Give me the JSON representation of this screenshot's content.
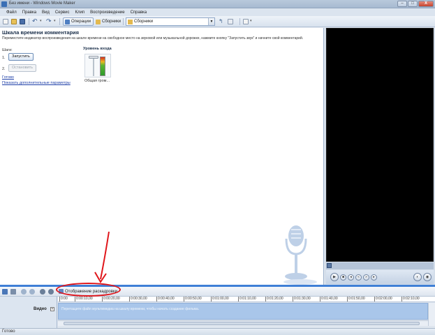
{
  "window": {
    "title": "Без имени - Windows Movie Maker",
    "minimize": "–",
    "maximize": "□",
    "close": "X"
  },
  "menu": [
    "Файл",
    "Правка",
    "Вид",
    "Сервис",
    "Клип",
    "Воспроизведение",
    "Справка"
  ],
  "toolbar": {
    "operations_label": "Операции",
    "collections_label": "Сборники",
    "collections_combo_value": "Сборники"
  },
  "pane": {
    "title": "Шкала времени комментария",
    "description": "Переместите индикатор воспроизведения на шкале времени на свободное место на звуковой или музыкальной дорожке, нажмите кнопку \"Запустить звук\" и начните свой комментарий.",
    "steps_label": "Шаги:",
    "step1_num": "1.",
    "step1_button": "Запустить",
    "step2_num": "2.",
    "step2_button": "Остановить",
    "done_link": "Готово",
    "more_options_link": "Показать дополнительные параметры",
    "input_level_title": "Уровень входа",
    "volume_label": "Общая гром..."
  },
  "storyboard": {
    "toggle_label": "Отображение раскадровки"
  },
  "timeline": {
    "track_label": "Видео",
    "track_expand": "+",
    "ticks": [
      "0:00",
      "0:00:10,00",
      "0:00:20,00",
      "0:00:30,00",
      "0:00:40,00",
      "0:00:50,00",
      "0:01:00,00",
      "0:01:10,00",
      "0:01:20,00",
      "0:01:30,00",
      "0:01:40,00",
      "0:01:50,00",
      "0:02:00,00",
      "0:02:10,00"
    ],
    "video_hint": "Перетащите файл мультимедиа на шкалу времени, чтобы начать создание фильма."
  },
  "status": {
    "text": "Готово"
  },
  "colors": {
    "accent": "#3f7fd6",
    "annotation": "#e0161b",
    "monitor": "#000000"
  }
}
